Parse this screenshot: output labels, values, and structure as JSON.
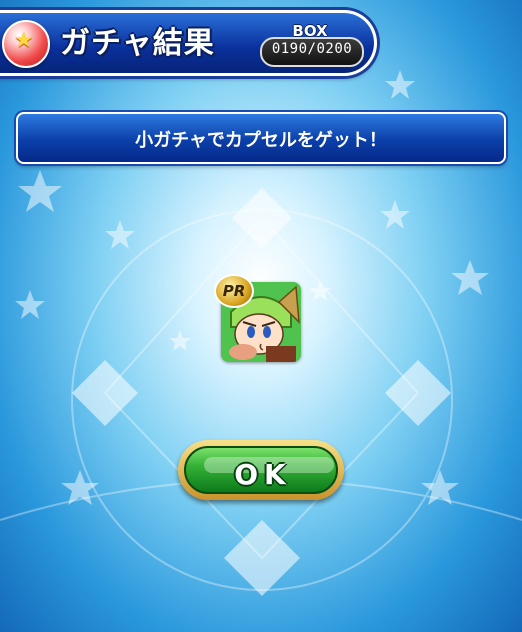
{
  "header": {
    "title": "ガチャ結果",
    "box_label": "BOX",
    "box_count": "0190/0200"
  },
  "banner": {
    "message": "小ガチャでカプセルをゲット！"
  },
  "item": {
    "badge": "PR"
  },
  "ok_button": {
    "label": "OK"
  },
  "icons": {
    "capsule": "gacha-capsule-icon",
    "badge": "pr-badge-icon"
  },
  "colors": {
    "header_blue": "#0a2f9a",
    "ok_green": "#35b236",
    "bg_light": "#d8f3ff"
  }
}
